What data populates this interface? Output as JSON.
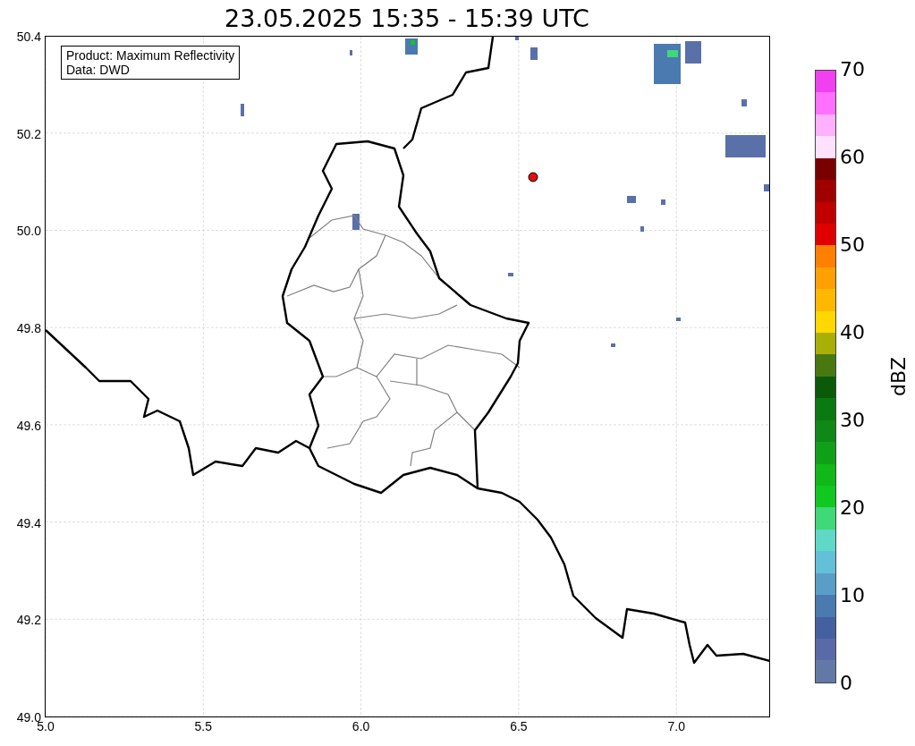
{
  "title": "23.05.2025 15:35 - 15:39 UTC",
  "info_box": [
    "Product: Maximum Reflectivity",
    "Data: DWD"
  ],
  "x_ticks": [
    "5.0",
    "5.5",
    "6.0",
    "6.5",
    "7.0"
  ],
  "y_ticks": [
    "50.4",
    "50.2",
    "50.0",
    "49.8",
    "49.6",
    "49.4",
    "49.2",
    "49.0"
  ],
  "colorbar": {
    "label": "dBZ",
    "ticks": [
      "70",
      "60",
      "50",
      "40",
      "30",
      "20",
      "10",
      "0"
    ],
    "segments": [
      {
        "color": "#6478a8"
      },
      {
        "color": "#5a6aa8"
      },
      {
        "color": "#4460a0"
      },
      {
        "color": "#4a7ab0"
      },
      {
        "color": "#5a9ec8"
      },
      {
        "color": "#62c0d8"
      },
      {
        "color": "#60d8c8"
      },
      {
        "color": "#40d878"
      },
      {
        "color": "#10c820"
      },
      {
        "color": "#10b818"
      },
      {
        "color": "#10a018"
      },
      {
        "color": "#108818"
      },
      {
        "color": "#0a7a10"
      },
      {
        "color": "#0a5a0a"
      },
      {
        "color": "#4a7810"
      },
      {
        "color": "#a8b008"
      },
      {
        "color": "#ffd800"
      },
      {
        "color": "#ffb800"
      },
      {
        "color": "#ffa000"
      },
      {
        "color": "#ff8000"
      },
      {
        "color": "#e00000"
      },
      {
        "color": "#c00000"
      },
      {
        "color": "#a00000"
      },
      {
        "color": "#780000"
      },
      {
        "color": "#ffe0ff"
      },
      {
        "color": "#ffb0ff"
      },
      {
        "color": "#ff70ff"
      },
      {
        "color": "#f040f0"
      }
    ]
  }
}
